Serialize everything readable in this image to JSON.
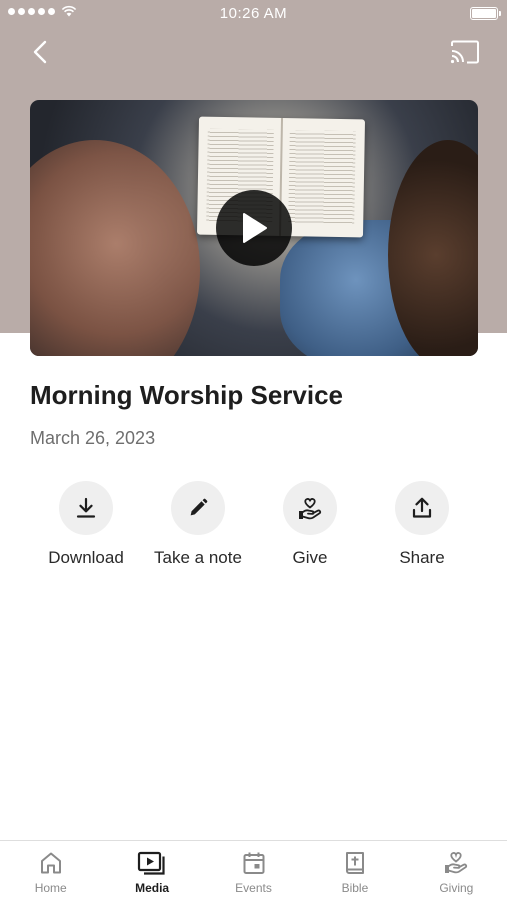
{
  "status_bar": {
    "time": "10:26 AM"
  },
  "media": {
    "title": "Morning Worship Service",
    "date": "March 26, 2023"
  },
  "actions": [
    {
      "label": "Download",
      "icon": "download-icon"
    },
    {
      "label": "Take a note",
      "icon": "pencil-icon"
    },
    {
      "label": "Give",
      "icon": "heart-hand-icon"
    },
    {
      "label": "Share",
      "icon": "share-icon"
    }
  ],
  "tabs": [
    {
      "label": "Home",
      "icon": "home-icon",
      "active": false
    },
    {
      "label": "Media",
      "icon": "media-icon",
      "active": true
    },
    {
      "label": "Events",
      "icon": "calendar-icon",
      "active": false
    },
    {
      "label": "Bible",
      "icon": "bible-icon",
      "active": false
    },
    {
      "label": "Giving",
      "icon": "giving-icon",
      "active": false
    }
  ],
  "colors": {
    "header_background": "#b9aca8",
    "active_tab": "#1e1e1e",
    "inactive_tab": "#8a8a8a",
    "action_circle": "#efefef"
  }
}
